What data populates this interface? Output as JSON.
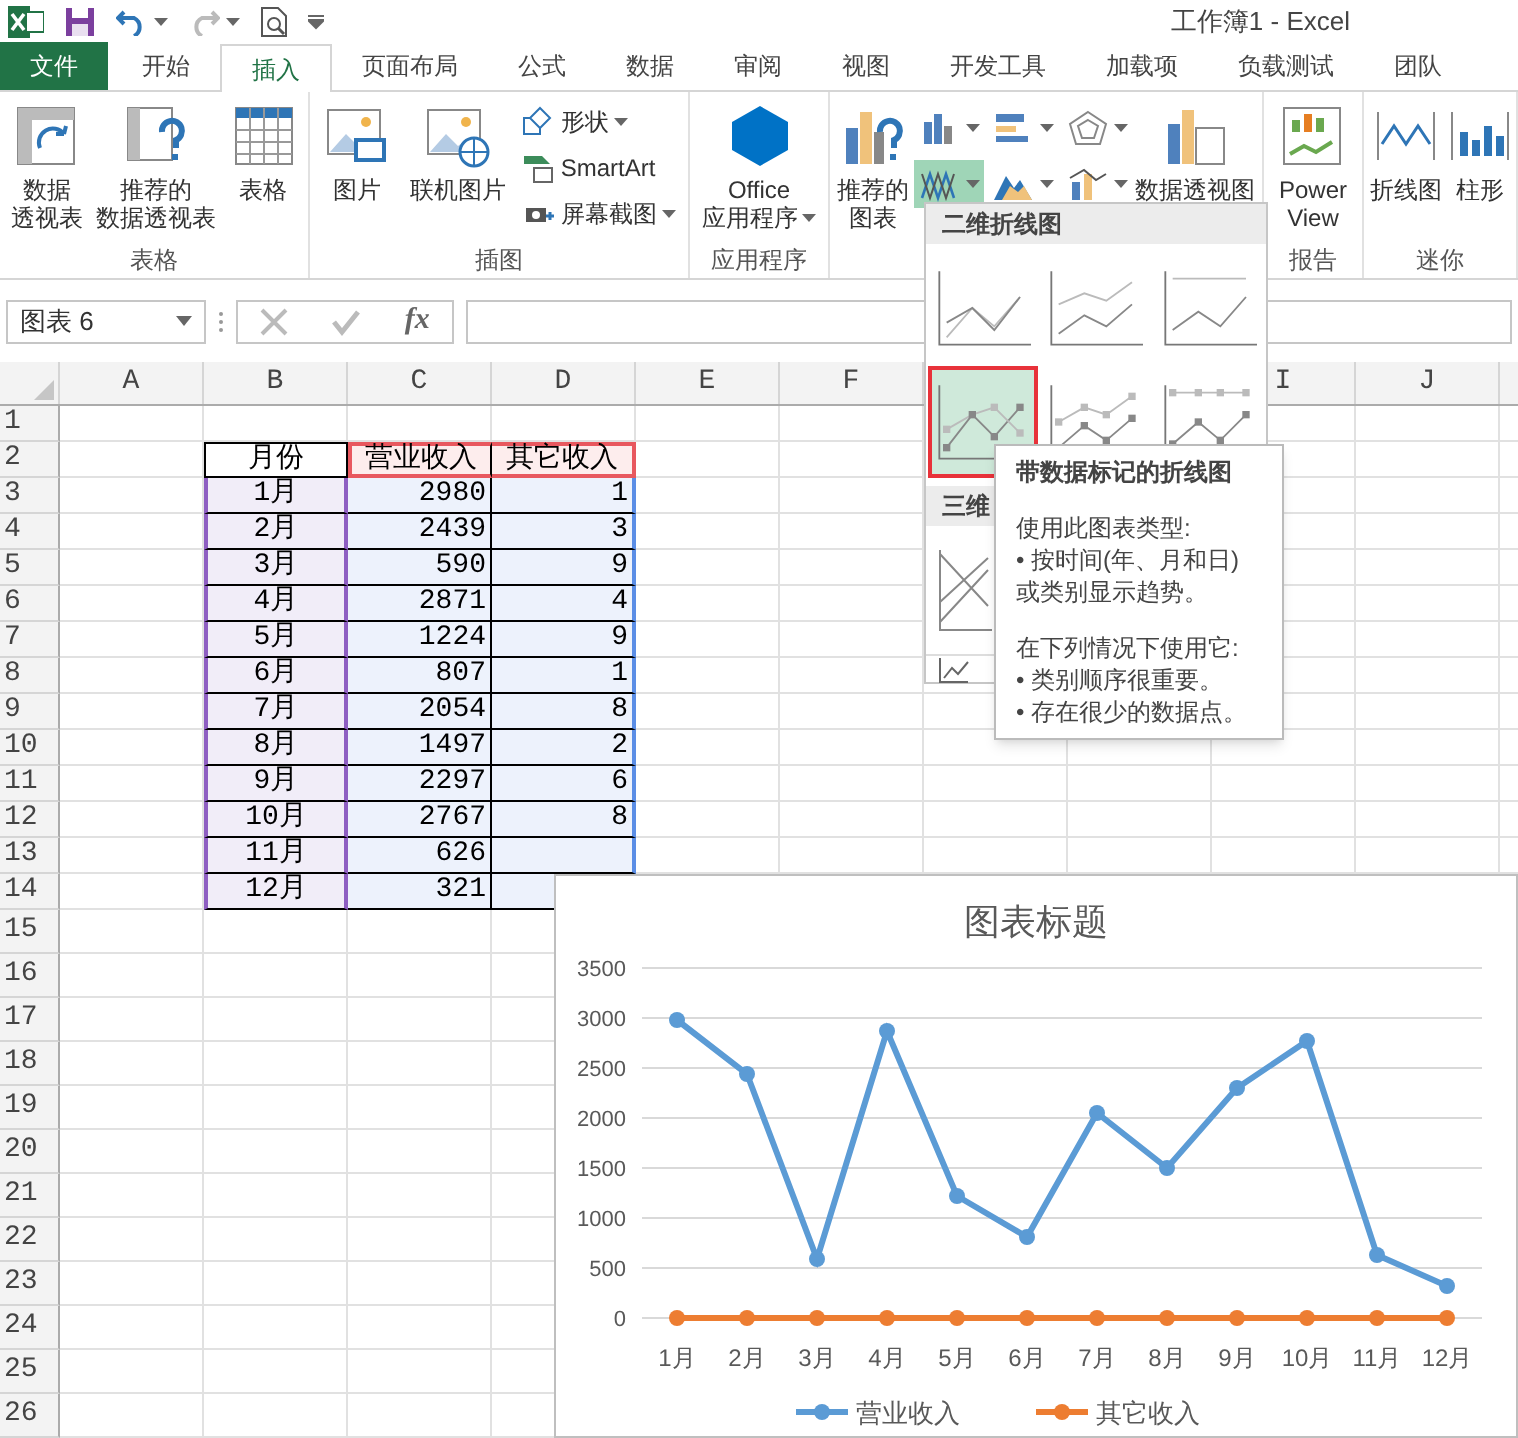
{
  "title_bar": {
    "title": "工作簿1 - Excel"
  },
  "ribbon_tabs": [
    {
      "label": "文件",
      "kind": "file",
      "selected": false
    },
    {
      "label": "开始",
      "kind": "tab",
      "selected": false
    },
    {
      "label": "插入",
      "kind": "tab",
      "selected": true
    },
    {
      "label": "页面布局",
      "kind": "tab",
      "selected": false
    },
    {
      "label": "公式",
      "kind": "tab",
      "selected": false
    },
    {
      "label": "数据",
      "kind": "tab",
      "selected": false
    },
    {
      "label": "审阅",
      "kind": "tab",
      "selected": false
    },
    {
      "label": "视图",
      "kind": "tab",
      "selected": false
    },
    {
      "label": "开发工具",
      "kind": "tab",
      "selected": false
    },
    {
      "label": "加载项",
      "kind": "tab",
      "selected": false
    },
    {
      "label": "负载测试",
      "kind": "tab",
      "selected": false
    },
    {
      "label": "团队",
      "kind": "tab",
      "selected": false
    }
  ],
  "ribbon_groups": [
    {
      "label": "表格",
      "buttons": [
        {
          "kind": "big",
          "lines": [
            "数据",
            "透视表"
          ]
        },
        {
          "kind": "big",
          "lines": [
            "推荐的",
            "数据透视表"
          ]
        },
        {
          "kind": "big",
          "lines": [
            "表格"
          ]
        }
      ]
    },
    {
      "label": "插图",
      "buttons": [
        {
          "kind": "big",
          "lines": [
            "图片"
          ]
        },
        {
          "kind": "big",
          "lines": [
            "联机图片"
          ]
        },
        {
          "kind": "small_stack",
          "items": [
            {
              "label": "形状",
              "has_menu": true
            },
            {
              "label": "SmartArt",
              "has_menu": false
            },
            {
              "label": "屏幕截图",
              "has_menu": true
            }
          ]
        }
      ]
    },
    {
      "label": "应用程序",
      "buttons": [
        {
          "kind": "big",
          "lines": [
            "Office",
            "应用程序"
          ],
          "has_menu": true
        }
      ]
    },
    {
      "buttons": [
        {
          "kind": "big",
          "lines": [
            "推荐的",
            "图表"
          ]
        },
        {
          "kind": "icon_grid",
          "items": [
            {
              "selected": false
            },
            {
              "selected": false
            },
            {
              "selected": false
            },
            {
              "selected": true
            },
            {
              "selected": false
            },
            {
              "selected": false
            }
          ]
        },
        {
          "kind": "big",
          "lines": [
            "数据透视图"
          ]
        }
      ]
    },
    {
      "label": "报告",
      "buttons": [
        {
          "kind": "big",
          "lines": [
            "Power",
            "View"
          ]
        }
      ]
    },
    {
      "label": "迷你",
      "buttons": [
        {
          "kind": "big",
          "lines": [
            "折线图"
          ]
        },
        {
          "kind": "big",
          "lines": [
            "柱形"
          ]
        }
      ]
    }
  ],
  "formula_bar": {
    "name_box": "图表 6",
    "fx": "fx"
  },
  "sheet": {
    "columns": [
      "A",
      "B",
      "C",
      "D",
      "E",
      "F",
      "I",
      "J"
    ],
    "rows": [
      {
        "label": "1",
        "kind": "blank"
      },
      {
        "label": "2",
        "kind": "header",
        "cells": [
          "月份",
          "营业收入",
          "其它收入"
        ]
      },
      {
        "label": "3",
        "kind": "data",
        "cells": [
          "1月",
          "2980",
          "1"
        ]
      },
      {
        "label": "4",
        "kind": "data",
        "cells": [
          "2月",
          "2439",
          "3"
        ]
      },
      {
        "label": "5",
        "kind": "data",
        "cells": [
          "3月",
          "590",
          "9"
        ]
      },
      {
        "label": "6",
        "kind": "data",
        "cells": [
          "4月",
          "2871",
          "4"
        ]
      },
      {
        "label": "7",
        "kind": "data",
        "cells": [
          "5月",
          "1224",
          "9"
        ]
      },
      {
        "label": "8",
        "kind": "data",
        "cells": [
          "6月",
          "807",
          "1"
        ]
      },
      {
        "label": "9",
        "kind": "data",
        "cells": [
          "7月",
          "2054",
          "8"
        ]
      },
      {
        "label": "10",
        "kind": "data",
        "cells": [
          "8月",
          "1497",
          "2"
        ]
      },
      {
        "label": "11",
        "kind": "data",
        "cells": [
          "9月",
          "2297",
          "6"
        ]
      },
      {
        "label": "12",
        "kind": "data",
        "cells": [
          "10月",
          "2767",
          "8"
        ]
      },
      {
        "label": "13",
        "kind": "data",
        "cells": [
          "11月",
          "626"
        ]
      },
      {
        "label": "14",
        "kind": "data",
        "cells": [
          "12月",
          "321"
        ]
      },
      {
        "label": "15",
        "kind": "blank"
      },
      {
        "label": "16",
        "kind": "blank"
      },
      {
        "label": "17",
        "kind": "blank"
      },
      {
        "label": "18",
        "kind": "blank"
      },
      {
        "label": "19",
        "kind": "blank"
      },
      {
        "label": "20",
        "kind": "blank"
      },
      {
        "label": "21",
        "kind": "blank"
      },
      {
        "label": "22",
        "kind": "blank"
      },
      {
        "label": "23",
        "kind": "blank"
      },
      {
        "label": "24",
        "kind": "blank"
      },
      {
        "label": "25",
        "kind": "blank"
      },
      {
        "label": "26",
        "kind": "blank"
      }
    ]
  },
  "line_menu": {
    "sections": [
      {
        "title": "二维折线图",
        "items": [
          {
            "kind": "line",
            "selected": false
          },
          {
            "kind": "stacked",
            "selected": false
          },
          {
            "kind": "percent",
            "selected": false
          },
          {
            "kind": "line_markers",
            "selected": true
          },
          {
            "kind": "stacked_markers",
            "selected": false
          },
          {
            "kind": "percent_markers",
            "selected": false
          }
        ]
      },
      {
        "title": "三维",
        "items": [
          {
            "kind": "perspective",
            "selected": false
          }
        ]
      }
    ]
  },
  "tooltip": {
    "title": "带数据标记的折线图",
    "paragraphs": [
      [
        "使用此图表类型:",
        "• 按时间(年、月和日)",
        "或类别显示趋势。"
      ],
      [
        "在下列情况下使用它:",
        "• 类别顺序很重要。",
        "• 存在很少的数据点。"
      ]
    ]
  },
  "chart": {
    "chart_data": {
      "type": "line",
      "title": "图表标题",
      "categories": [
        "1月",
        "2月",
        "3月",
        "4月",
        "5月",
        "6月",
        "7月",
        "8月",
        "9月",
        "10月",
        "11月",
        "12月"
      ],
      "series": [
        {
          "name": "营业收入",
          "color": "#5b9bd5",
          "marker": "circle",
          "values": [
            2980,
            2440,
            590,
            2870,
            1220,
            810,
            2050,
            1500,
            2300,
            2770,
            630,
            320
          ]
        },
        {
          "name": "其它收入",
          "color": "#ed7d31",
          "marker": "circle",
          "values": [
            0,
            0,
            0,
            0,
            0,
            0,
            0,
            0,
            0,
            0,
            0,
            0
          ]
        }
      ],
      "grid": true,
      "legend": "bottom",
      "ylim": [
        0,
        3500
      ],
      "yticks": [
        0,
        500,
        1000,
        1500,
        2000,
        2500,
        3000,
        3500
      ]
    }
  }
}
